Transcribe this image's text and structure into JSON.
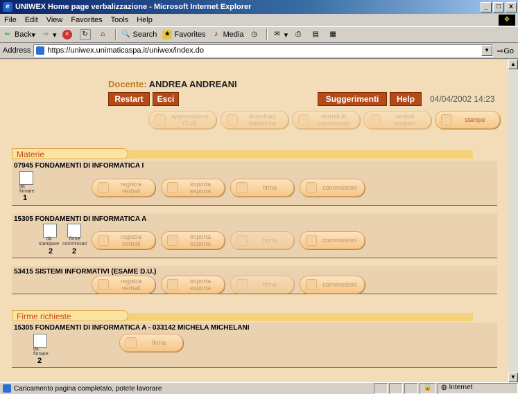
{
  "window": {
    "title": "UNIWEX Home page verbalizzazione - Microsoft Internet Explorer",
    "controls": [
      "_",
      "□",
      "x"
    ]
  },
  "menu": [
    "File",
    "Edit",
    "View",
    "Favorites",
    "Tools",
    "Help"
  ],
  "toolbar": {
    "back": "Back",
    "search": "Search",
    "favorites": "Favorites",
    "media": "Media"
  },
  "address": {
    "label": "Address",
    "url": "https://uniwex.unimaticaspa.it/uniwex/index.do",
    "go": "Go"
  },
  "header": {
    "docente_label": "Docente:",
    "docente_name": "ANDREA ANDREANI",
    "restart": "Restart",
    "esci": "Esci",
    "suggerimenti": "Suggerimenti",
    "help": "Help",
    "datetime": "04/04/2002 14:23"
  },
  "top_actions": [
    {
      "l1": "approvazione",
      "l2": "CLdL"
    },
    {
      "l1": "download",
      "l2": "statistiche"
    },
    {
      "l1": "verbali ai",
      "l2": "commissari"
    },
    {
      "l1": "verbali",
      "l2": "sospesi"
    },
    {
      "l1": "stampe",
      "l2": ""
    }
  ],
  "materie": {
    "label": "Materie",
    "courses": [
      {
        "title": "07945 FONDAMENTI DI INFORMATICA I",
        "icons": [
          {
            "lbl1": "da",
            "lbl2": "firmare",
            "count": "1"
          }
        ],
        "actions": [
          {
            "l1": "registra",
            "l2": "verbali"
          },
          {
            "l1": "importa",
            "l2": "esporta"
          },
          {
            "l1": "firma",
            "l2": ""
          },
          {
            "l1": "commissioni",
            "l2": ""
          }
        ]
      },
      {
        "title": "15305 FONDAMENTI DI INFORMATICA A",
        "icons": [
          {
            "lbl1": "da",
            "lbl2": "stampare",
            "count": "2"
          },
          {
            "lbl1": "firme",
            "lbl2": "commissari",
            "count": "2"
          }
        ],
        "actions": [
          {
            "l1": "registra",
            "l2": "verbali"
          },
          {
            "l1": "importa",
            "l2": "esporta"
          },
          {
            "l1": "firma",
            "l2": ""
          },
          {
            "l1": "commissioni",
            "l2": ""
          }
        ]
      },
      {
        "title": "53415 SISTEMI INFORMATIVI (ESAME D.U.)",
        "actions": [
          {
            "l1": "registra",
            "l2": "verbali"
          },
          {
            "l1": "importa",
            "l2": "esporta"
          },
          {
            "l1": "firma",
            "l2": ""
          },
          {
            "l1": "commissioni",
            "l2": ""
          }
        ]
      }
    ]
  },
  "firme": {
    "label": "Firme richieste",
    "title": "15305 FONDAMENTI DI INFORMATICA A  -  033142 MICHELA MICHELANI",
    "icon_lbl1": "da",
    "icon_lbl2": "firmare",
    "count": "2",
    "action": "firma"
  },
  "status": {
    "text": "Caricamento pagina completato, potete lavorare",
    "zone": "Internet"
  }
}
